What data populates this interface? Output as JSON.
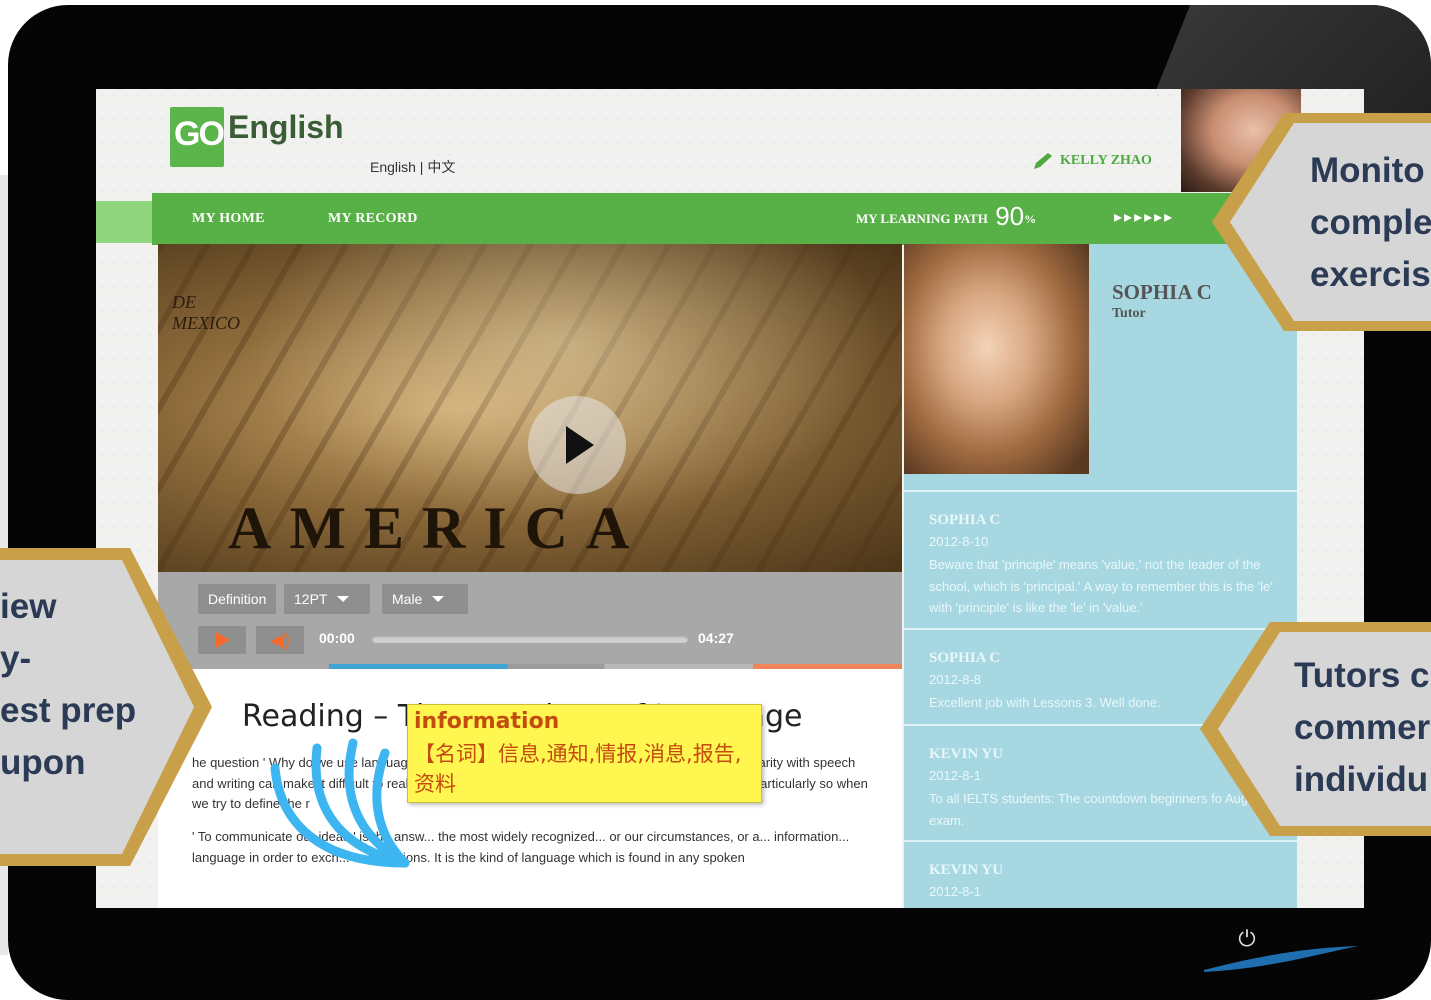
{
  "brand": {
    "logo_go": "GO",
    "logo_english": "English"
  },
  "header": {
    "language_switch": "English | 中文",
    "user_name": "KELLY ZHAO"
  },
  "nav": {
    "items": [
      "MY HOME",
      "MY RECORD"
    ],
    "learning_path_label": "MY LEARNING PATH",
    "learning_path_value": "90",
    "learning_path_unit": "%",
    "arrows": "▸▸▸▸▸▸"
  },
  "player": {
    "definition_label": "Definition",
    "font_size": "12PT",
    "voice": "Male",
    "current_time": "00:00",
    "duration": "04:27",
    "progress": 0
  },
  "reading": {
    "title": "Reading – The Functions of Language",
    "paragraph1": "he question ' Why do we use language? ' hardly seems to need an answer. But our everyday familiarity with speech and writing can make it difficult to realise how complex the skills are that we have learned. This is particularly so when we try to define the r",
    "paragraph2": "' To communicate our ideas ' is the answ... the most widely recognized... or our circumstances, or a... information... language in order to exch... and opinions. It is the kind of language which is found in any spoken",
    "popup_word": "information",
    "popup_definition": "【名词】信息,通知,情报,消息,报告,资料"
  },
  "tutor": {
    "name": "SOPHIA C",
    "role": "Tutor",
    "comments": [
      {
        "author": "SOPHIA C",
        "date": "2012-8-10",
        "text": "Beware that 'principle' means 'value,' not the leader of the school, which is 'principal.' A way to remember this is the 'le' with 'principle' is like the 'le' in 'value.'"
      },
      {
        "author": "SOPHIA C",
        "date": "2012-8-8",
        "text": "Excellent job with Lessons 3. Well done."
      },
      {
        "author": "KEVIN YU",
        "date": "2012-8-1",
        "text": "To all IELTS students: The countdown beginners fo August exam."
      },
      {
        "author": "KEVIN YU",
        "date": "2012-8-1",
        "text": ""
      }
    ]
  },
  "callouts": {
    "right_top": [
      "Monito",
      "comple",
      "exercis"
    ],
    "right_bottom": [
      "Tutors c",
      "commer",
      "individu"
    ],
    "left": [
      "iew",
      "y-",
      "est prep",
      "upon"
    ]
  },
  "colors": {
    "brand_green": "#58b146",
    "panel_blue": "#a7d8e2",
    "accent_orange": "#f36a2a",
    "callout_gold": "#c9a04a"
  },
  "icons": [
    "pencil-icon",
    "play-icon",
    "volume-icon",
    "caret-down-icon",
    "power-icon"
  ]
}
